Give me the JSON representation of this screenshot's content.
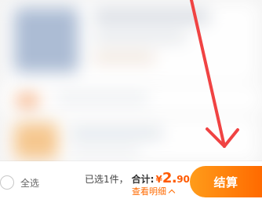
{
  "footer": {
    "select_all_label": "全选",
    "selected_count_text": "已选1件，",
    "total_label": "合计:",
    "currency_symbol": "¥",
    "price_integer": "2.",
    "price_decimal": "90",
    "details_link": "查看明细",
    "checkout_label": "结算"
  },
  "colors": {
    "accent": "#ff6a00",
    "checkout_gradient_start": "#ff9c1a",
    "checkout_gradient_end": "#ff6a00",
    "arrow_red": "#f04343"
  },
  "icons": {
    "select_all": "circle-checkbox-icon",
    "details_caret": "caret-up-icon",
    "annotation": "red-arrow-icon"
  }
}
